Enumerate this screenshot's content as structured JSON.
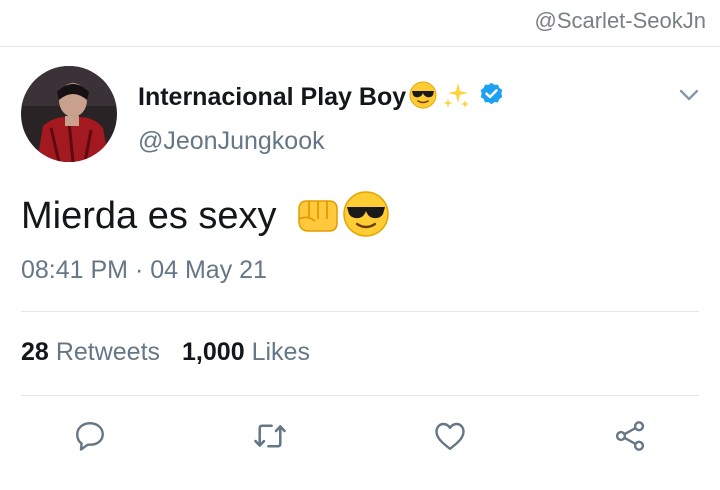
{
  "watermark": "@Scarlet-SeokJn",
  "tweet": {
    "display_name": "Internacional Play Boy",
    "name_emojis": [
      "sunglasses-face-icon",
      "sparkles-icon"
    ],
    "verified": true,
    "handle": "@JeonJungkook",
    "text": "Mierda es sexy",
    "text_emojis": [
      "oncoming-fist-icon",
      "sunglasses-face-icon"
    ],
    "timestamp": "08:41 PM · 04 May 21",
    "retweets_count": "28",
    "retweets_label": "Retweets",
    "likes_count": "1,000",
    "likes_label": "Likes"
  },
  "actions": [
    "reply-icon",
    "retweet-icon",
    "like-icon",
    "share-icon"
  ],
  "colors": {
    "text_primary": "#14171a",
    "text_secondary": "#657786",
    "divider": "#e1e8ed",
    "verified_blue": "#1da1f2",
    "icon_gray": "#657786"
  }
}
